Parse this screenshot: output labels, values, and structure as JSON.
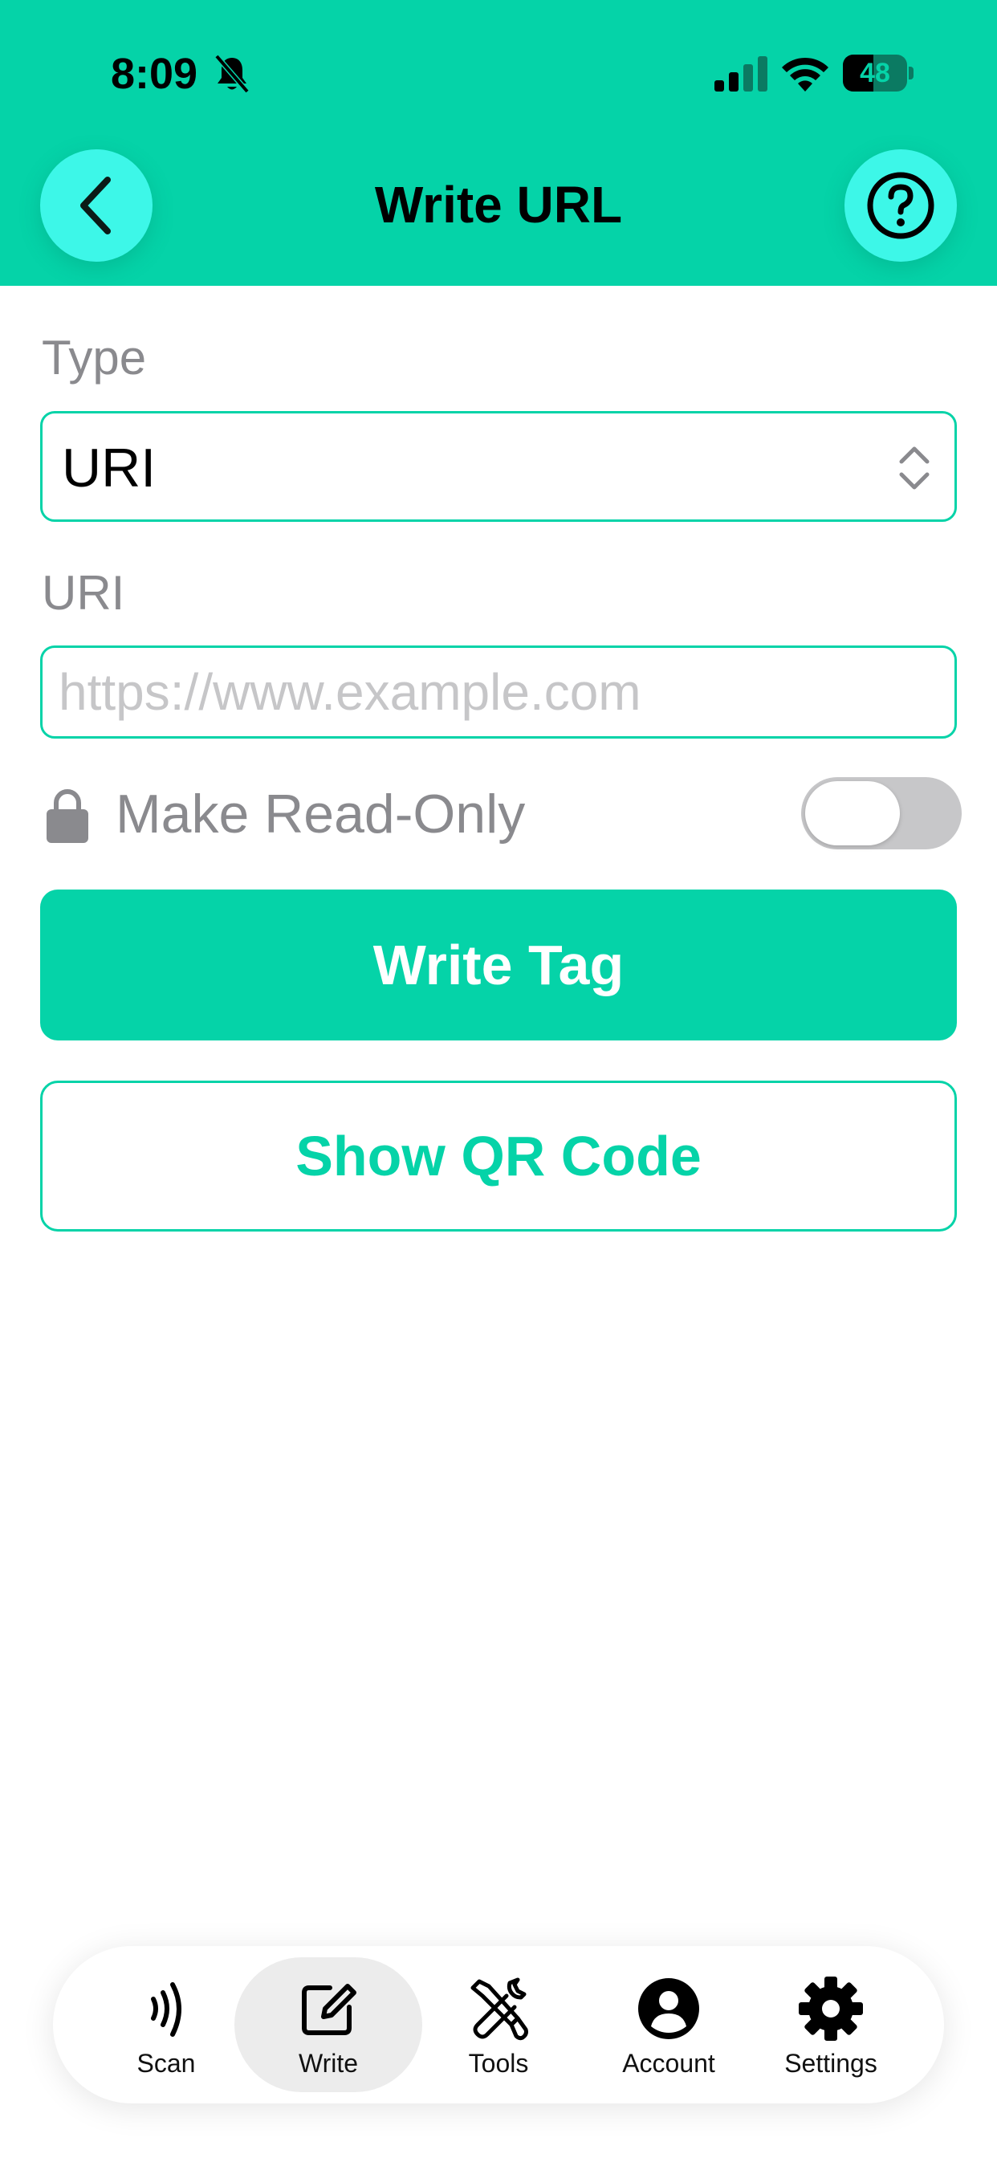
{
  "status_bar": {
    "time": "8:09",
    "battery": "48",
    "battery_level": 0.48,
    "icons": [
      "bell-slash-icon",
      "signal-icon",
      "wifi-icon",
      "battery-icon"
    ]
  },
  "header": {
    "title": "Write URL",
    "back_icon": "chevron-left-icon",
    "help_icon": "question-circle-icon"
  },
  "form": {
    "type_label": "Type",
    "type_value": "URI",
    "uri_label": "URI",
    "uri_value": "",
    "uri_placeholder": "https://www.example.com",
    "read_only_label": "Make Read-Only",
    "read_only_enabled": false
  },
  "actions": {
    "write_tag": "Write Tag",
    "show_qr": "Show QR Code"
  },
  "tabbar": {
    "items": [
      {
        "label": "Scan",
        "icon": "nfc-wave-icon",
        "active": false
      },
      {
        "label": "Write",
        "icon": "edit-icon",
        "active": true
      },
      {
        "label": "Tools",
        "icon": "tools-icon",
        "active": false
      },
      {
        "label": "Account",
        "icon": "user-circle-icon",
        "active": false
      },
      {
        "label": "Settings",
        "icon": "gear-icon",
        "active": false
      }
    ]
  },
  "colors": {
    "accent": "#05d3a8",
    "header_button": "#3df7e8",
    "label_gray": "#8a8a8e",
    "placeholder_gray": "#c6c6c8",
    "toggle_off": "#c7c7c9"
  }
}
